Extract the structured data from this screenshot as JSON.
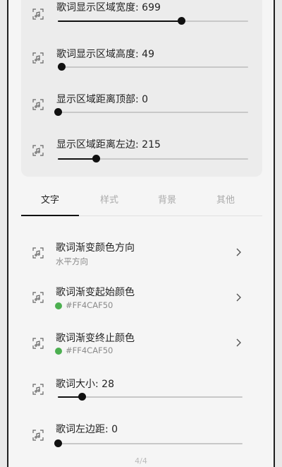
{
  "top_card": {
    "items": [
      {
        "label": "歌词显示区域宽度: 699",
        "fraction": 0.648
      },
      {
        "label": "歌词显示区域高度: 49",
        "fraction": 0.02
      },
      {
        "label": "显示区域距离顶部: 0",
        "fraction": 0.0
      },
      {
        "label": "显示区域距离左边: 215",
        "fraction": 0.2
      }
    ]
  },
  "tabs": [
    {
      "label": "文字",
      "active": true
    },
    {
      "label": "样式",
      "active": false
    },
    {
      "label": "背景",
      "active": false
    },
    {
      "label": "其他",
      "active": false
    }
  ],
  "settings": {
    "gradient_direction": {
      "label": "歌词渐变颜色方向",
      "value": "水平方向"
    },
    "gradient_start": {
      "label": "歌词渐变起始颜色",
      "value": "#FF4CAF50",
      "color": "#4CAF50"
    },
    "gradient_end": {
      "label": "歌词渐变终止颜色",
      "value": "#FF4CAF50",
      "color": "#4CAF50"
    },
    "lyric_size": {
      "label": "歌词大小: 28",
      "fraction": 0.13
    },
    "left_margin": {
      "label": "歌词左边距: 0",
      "fraction": 0.0
    }
  },
  "pager": {
    "text": "4/4"
  },
  "icons": {
    "setting": "lyric-frame-icon",
    "chevron": "chevron-right-icon"
  }
}
